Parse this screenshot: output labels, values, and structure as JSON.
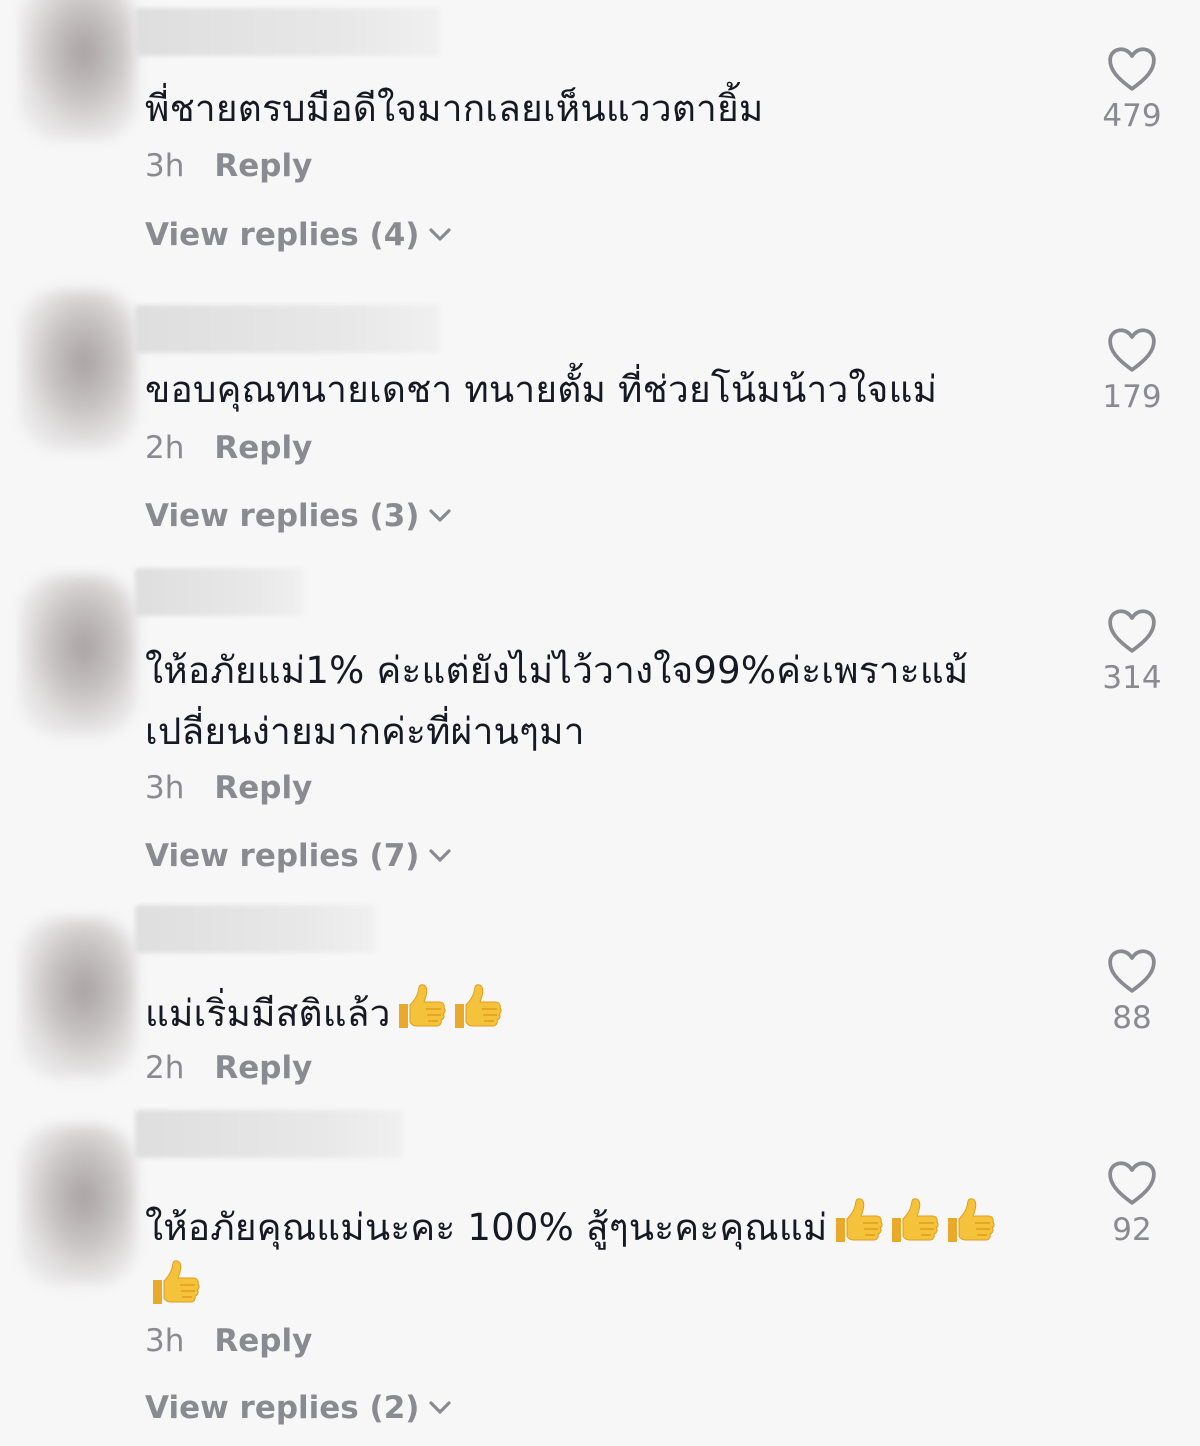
{
  "comments": [
    {
      "text": "พี่ชายตรบมือดีใจมากเลยเห็นแววตายิ้ม",
      "time": "3h",
      "reply_label": "Reply",
      "view_replies": "View replies (4)",
      "likes": "479"
    },
    {
      "text": "ขอบคุณทนายเดชา ทนายตั้ม ที่ช่วยโน้มน้าวใจแม่",
      "time": "2h",
      "reply_label": "Reply",
      "view_replies": "View replies (3)",
      "likes": "179"
    },
    {
      "text_line1": "ให้อภัยแม่1% ค่ะแต่ยังไม่ไว้วางใจ99%ค่ะเพราะแม้",
      "text_line2": "เปลี่ยนง่ายมากค่ะที่ผ่านๆมา",
      "time": "3h",
      "reply_label": "Reply",
      "view_replies": "View replies (7)",
      "likes": "314"
    },
    {
      "text": "แม่เริ่มมีสติแล้ว",
      "emoji": "thumbs-up x2",
      "time": "2h",
      "reply_label": "Reply",
      "likes": "88"
    },
    {
      "text": "ให้อภัยคุณแม่นะคะ 100% สู้ๆนะคะคุณแม่",
      "emoji": "thumbs-up x4",
      "time": "3h",
      "reply_label": "Reply",
      "view_replies": "View replies (2)",
      "likes": "92"
    }
  ],
  "colors": {
    "text": "#161823",
    "meta": "#8a8b91",
    "background": "#f7f7f7",
    "emoji": "#f5c33b"
  }
}
